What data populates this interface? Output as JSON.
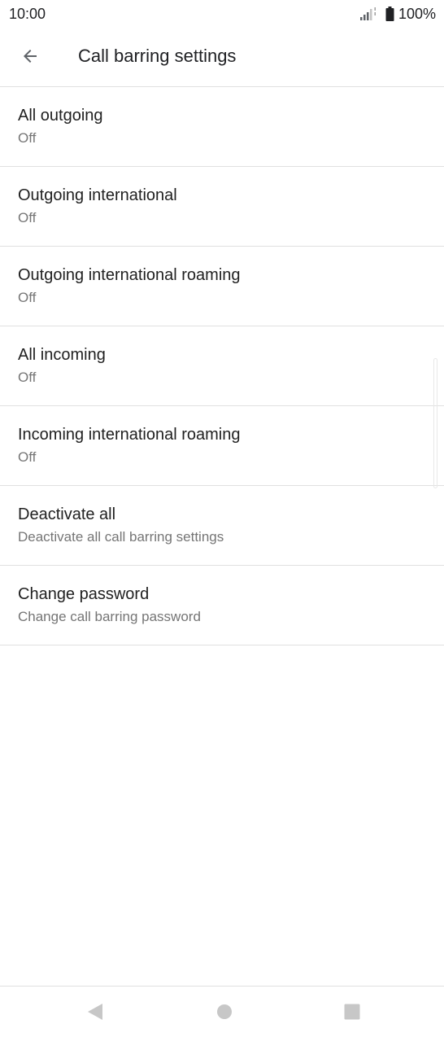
{
  "status_bar": {
    "time": "10:00",
    "battery": "100%",
    "icons": [
      "signal-icon",
      "battery-icon"
    ]
  },
  "app_bar": {
    "title": "Call barring settings",
    "back_icon": "arrow-back-icon"
  },
  "settings": {
    "items": [
      {
        "title": "All outgoing",
        "summary": "Off"
      },
      {
        "title": "Outgoing international",
        "summary": "Off"
      },
      {
        "title": "Outgoing international roaming",
        "summary": "Off"
      },
      {
        "title": "All incoming",
        "summary": "Off"
      },
      {
        "title": "Incoming international roaming",
        "summary": "Off"
      },
      {
        "title": "Deactivate all",
        "summary": "Deactivate all call barring settings"
      },
      {
        "title": "Change password",
        "summary": "Change call barring password"
      }
    ]
  },
  "nav_bar": {
    "icons": [
      "nav-back-icon",
      "nav-home-icon",
      "nav-recents-icon"
    ]
  },
  "colors": {
    "text_primary": "#212121",
    "text_secondary": "#757575",
    "divider": "#e0e0e0",
    "nav_icon": "#c7c7c7"
  }
}
